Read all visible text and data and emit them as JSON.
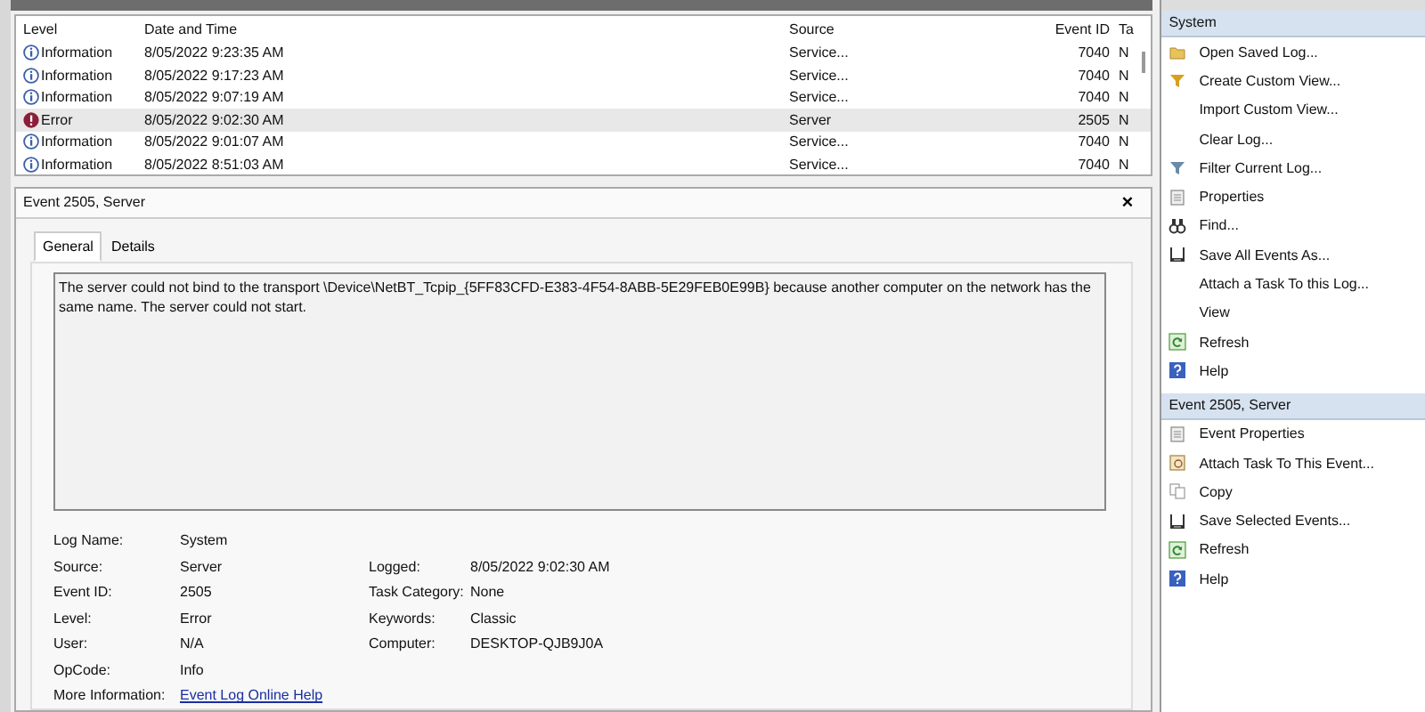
{
  "events_table": {
    "columns": [
      "Level",
      "Date and Time",
      "Source",
      "Event ID",
      "Ta"
    ],
    "rows": [
      {
        "level": "Information",
        "kind": "information",
        "date": "8/05/2022 9:23:35 AM",
        "source": "Service...",
        "event_id": "7040",
        "task": "N",
        "selected": false
      },
      {
        "level": "Information",
        "kind": "information",
        "date": "8/05/2022 9:17:23 AM",
        "source": "Service...",
        "event_id": "7040",
        "task": "N",
        "selected": false
      },
      {
        "level": "Information",
        "kind": "information",
        "date": "8/05/2022 9:07:19 AM",
        "source": "Service...",
        "event_id": "7040",
        "task": "N",
        "selected": false
      },
      {
        "level": "Error",
        "kind": "error",
        "date": "8/05/2022 9:02:30 AM",
        "source": "Server",
        "event_id": "2505",
        "task": "N",
        "selected": true
      },
      {
        "level": "Information",
        "kind": "information",
        "date": "8/05/2022 9:01:07 AM",
        "source": "Service...",
        "event_id": "7040",
        "task": "N",
        "selected": false
      },
      {
        "level": "Information",
        "kind": "information",
        "date": "8/05/2022 8:51:03 AM",
        "source": "Service...",
        "event_id": "7040",
        "task": "N",
        "selected": false
      }
    ]
  },
  "event_panel": {
    "title": "Event 2505, Server",
    "close": "×",
    "tabs": [
      {
        "label": "General",
        "selected": true
      },
      {
        "label": "Details",
        "selected": false
      }
    ],
    "description": "The server could not bind to the transport \\Device\\NetBT_Tcpip_{5FF83CFD-E383-4F54-8ABB-5E29FEB0E99B} because another computer on the network has the same name.  The server could not start.",
    "details_left": [
      {
        "label": "Log Name:",
        "value": "System"
      },
      {
        "label": "Source:",
        "value": "Server"
      },
      {
        "label": "Event ID:",
        "value": "2505"
      },
      {
        "label": "Level:",
        "value": "Error"
      },
      {
        "label": "User:",
        "value": "N/A"
      },
      {
        "label": "OpCode:",
        "value": "Info"
      }
    ],
    "details_right": [
      {
        "label": "Logged:",
        "value": "8/05/2022 9:02:30 AM"
      },
      {
        "label": "Task Category:",
        "value": "None"
      },
      {
        "label": "Keywords:",
        "value": "Classic"
      },
      {
        "label": "Computer:",
        "value": "DESKTOP-QJB9J0A"
      }
    ],
    "more_info": {
      "label": "More Information:",
      "link": "Event Log Online Help"
    }
  },
  "actions": {
    "sections": [
      {
        "title": "System",
        "items": [
          {
            "label": "Open Saved Log...",
            "kind": "folder"
          },
          {
            "label": "Create Custom View...",
            "kind": "funnel"
          },
          {
            "label": "Import Custom View...",
            "kind": "none"
          },
          {
            "label": "Clear Log...",
            "kind": "none"
          },
          {
            "label": "Filter Current Log...",
            "kind": "filter"
          },
          {
            "label": "Properties",
            "kind": "properties"
          },
          {
            "label": "Find...",
            "kind": "find"
          },
          {
            "label": "Save All Events As...",
            "kind": "save"
          },
          {
            "label": "Attach a Task To this Log...",
            "kind": "none"
          },
          {
            "label": "View",
            "kind": "none"
          },
          {
            "label": "Refresh",
            "kind": "refresh"
          },
          {
            "label": "Help",
            "kind": "help"
          }
        ]
      },
      {
        "title": "Event 2505, Server",
        "items": [
          {
            "label": "Event Properties",
            "kind": "properties"
          },
          {
            "label": "Attach Task To This Event...",
            "kind": "attach"
          },
          {
            "label": "Copy",
            "kind": "copy"
          },
          {
            "label": "Save Selected Events...",
            "kind": "save"
          },
          {
            "label": "Refresh",
            "kind": "refresh"
          },
          {
            "label": "Help",
            "kind": "help"
          }
        ]
      }
    ]
  }
}
